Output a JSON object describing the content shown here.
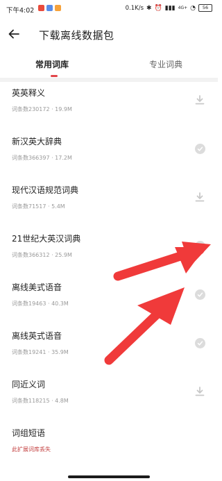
{
  "status_bar": {
    "time": "下午4:02",
    "network_speed": "0.1K/s",
    "network_type": "4G+",
    "battery": "56"
  },
  "header": {
    "title": "下载离线数据包"
  },
  "tabs": [
    {
      "label": "常用词库",
      "active": true
    },
    {
      "label": "专业词典",
      "active": false
    }
  ],
  "items": [
    {
      "title": "英英释义",
      "meta": "词条数230172 · 19.9M",
      "status": "download"
    },
    {
      "title": "新汉英大辞典",
      "meta": "词条数366397 · 17.2M",
      "status": "downloaded"
    },
    {
      "title": "现代汉语规范词典",
      "meta": "词条数71517 · 5.4M",
      "status": "download"
    },
    {
      "title": "21世纪大英汉词典",
      "meta": "词条数366312 · 25.9M",
      "status": "downloaded"
    },
    {
      "title": "离线美式语音",
      "meta": "词条数19463 · 40.3M",
      "status": "downloaded"
    },
    {
      "title": "离线英式语音",
      "meta": "词条数19241 · 35.9M",
      "status": "downloaded"
    },
    {
      "title": "同近义词",
      "meta": "词条数118215 · 4.8M",
      "status": "download"
    },
    {
      "title": "词组短语",
      "meta": "此扩展词库丢失",
      "status": "missing"
    }
  ],
  "colors": {
    "accent": "#e2464b",
    "arrow": "#f03a3a",
    "meta_text": "#999999",
    "warning_text": "#c44242",
    "check_bg": "#dcdcdc"
  }
}
